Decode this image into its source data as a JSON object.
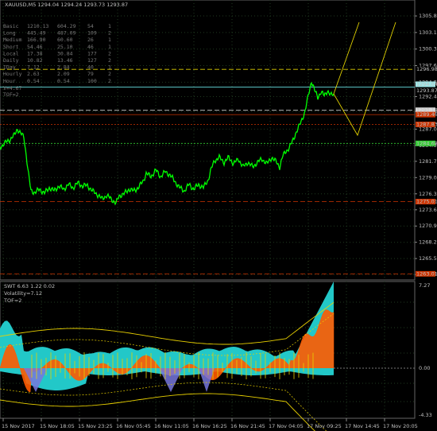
{
  "window": {
    "title": "XAUUSD,M5  1294.04 1294.24 1293.73 1293.87"
  },
  "stats_table": {
    "rows": [
      {
        "label": "Basic",
        "a": "1210.13",
        "b": "604.29",
        "c": "54",
        "d": "1"
      },
      {
        "label": "Long",
        "a": "445.49",
        "b": "487.09",
        "c": "109",
        "d": "2"
      },
      {
        "label": "Medium",
        "a": "166.90",
        "b": "60.60",
        "c": "26",
        "d": "1"
      },
      {
        "label": "Short",
        "a": "54.46",
        "b": "25.10",
        "c": "46",
        "d": "1"
      },
      {
        "label": "Local",
        "a": "17.38",
        "b": "30.84",
        "c": "177",
        "d": "2"
      },
      {
        "label": "Daily",
        "a": "10.82",
        "b": "13.46",
        "c": "127",
        "d": "2"
      },
      {
        "label": "IDay",
        "a": "7.12",
        "b": "2.84",
        "c": "40",
        "d": "1"
      },
      {
        "label": "Hourly",
        "a": "2.63",
        "b": "2.09",
        "c": "79",
        "d": "2"
      },
      {
        "label": "Hour",
        "a": "0.54",
        "b": "0.54",
        "c": "100",
        "d": "2"
      }
    ],
    "v_label": "V=4.67",
    "tof_label": "TOF=2"
  },
  "main_chart": {
    "price_ticks": [
      "1305.85",
      "1303.10",
      "1300.35",
      "1297.60",
      "1294.85",
      "1292.45",
      "1290.00",
      "1287.05",
      "1284.35",
      "1281.70",
      "1279.00",
      "1276.30",
      "1273.65",
      "1270.95",
      "1268.25",
      "1265.55",
      "1262.90"
    ],
    "level_labels": [
      {
        "text": "1296.98",
        "color": "#ffffff",
        "bg": "#000000"
      },
      {
        "text": "1294.04",
        "color": "#000000",
        "bg": "#9ee6e6"
      },
      {
        "text": "1293.87",
        "color": "#ffffff",
        "bg": "#000000"
      },
      {
        "text": "1290.18",
        "color": "#000000",
        "bg": "#d8d8d8"
      },
      {
        "text": "1289.46",
        "color": "#ffffff",
        "bg": "#cc3300"
      },
      {
        "text": "1287.83",
        "color": "#ffffff",
        "bg": "#cc3300"
      },
      {
        "text": "1284.68",
        "color": "#000000",
        "bg": "#33cc33"
      },
      {
        "text": "1275.01",
        "color": "#ffffff",
        "bg": "#cc3300"
      },
      {
        "text": "1263.01",
        "color": "#ffffff",
        "bg": "#cc3300"
      }
    ],
    "colors": {
      "price_line": "#00ff00",
      "projection": "#e0d000",
      "level_red": "#cc3300",
      "level_green": "#33cc33",
      "level_cyan": "#66dddd"
    }
  },
  "indicator": {
    "title": "SWT 6.63 1.22 0.02",
    "volatility": "Volatility=7.12",
    "tof": "TOF=2",
    "ticks": [
      "7.27",
      "0.00",
      "-4.33"
    ]
  },
  "time_axis": [
    "15 Nov 2017",
    "15 Nov 18:05",
    "15 Nov 23:25",
    "16 Nov 05:45",
    "16 Nov 11:05",
    "16 Nov 16:25",
    "16 Nov 21:45",
    "17 Nov 04:05",
    "17 Nov 09:25",
    "17 Nov 14:45",
    "17 Nov 20:05"
  ]
}
